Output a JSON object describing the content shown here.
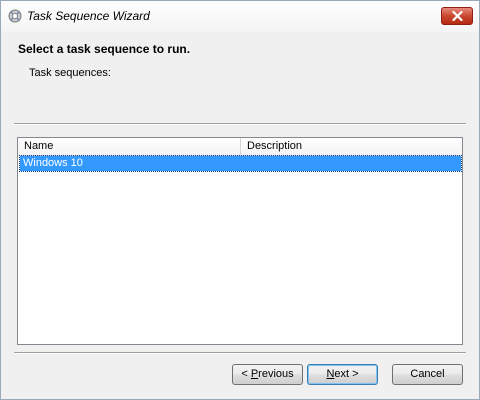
{
  "window": {
    "title": "Task Sequence Wizard",
    "icons": {
      "app": "gear-cd-icon",
      "close": "close-icon"
    }
  },
  "header": {
    "heading": "Select a task sequence to run.",
    "subheading": "Task sequences:"
  },
  "list": {
    "columns": [
      "Name",
      "Description"
    ],
    "rows": [
      {
        "name": "Windows 10",
        "description": "",
        "selected": true
      }
    ]
  },
  "buttons": {
    "previous": {
      "prefix": "< ",
      "mnemonic": "P",
      "rest": "revious"
    },
    "next": {
      "mnemonic": "N",
      "rest": "ext >"
    },
    "cancel": "Cancel"
  },
  "colors": {
    "selection": "#3399ff",
    "close_button": "#c9482f"
  }
}
